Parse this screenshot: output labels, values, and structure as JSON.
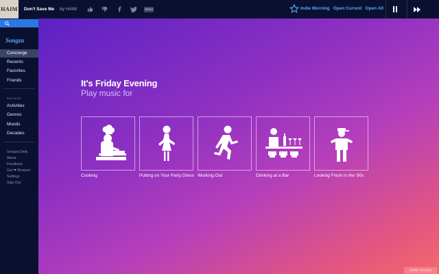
{
  "player": {
    "album_art_text": "HAIM",
    "track": "Don't Save Me",
    "artist": "by HAIM",
    "share_label": "Share",
    "station_name": "Indie Morning",
    "open_current": "Open Current",
    "open_all": "Open All",
    "icons": [
      "thumbs-up-icon",
      "thumbs-down-icon",
      "facebook-icon",
      "twitter-icon",
      "share-icon",
      "star-icon",
      "pause-icon",
      "skip-icon"
    ]
  },
  "sidebar": {
    "logo": "Songza",
    "primary": [
      "Concierge",
      "Recents",
      "Favorites",
      "Friends"
    ],
    "browse_heading": "BROWSE",
    "browse": [
      "Activities",
      "Genres",
      "Moods",
      "Decades"
    ],
    "secondary": [
      "Songza Daily",
      "About",
      "Feedback",
      "Get ❤ Browser",
      "Settings",
      "Sign Out"
    ]
  },
  "main": {
    "title": "It's Friday Evening",
    "subtitle": "Play music for",
    "cards": [
      {
        "label": "Cooking",
        "icon": "chef-icon"
      },
      {
        "label": "Putting on Your Party Dress",
        "icon": "dress-icon"
      },
      {
        "label": "Working Out",
        "icon": "runner-icon"
      },
      {
        "label": "Drinking at a Bar",
        "icon": "bar-icon"
      },
      {
        "label": "Looking Fresh in the '90s",
        "icon": "fresh-icon"
      }
    ]
  },
  "corner_button": "Undo Screen"
}
